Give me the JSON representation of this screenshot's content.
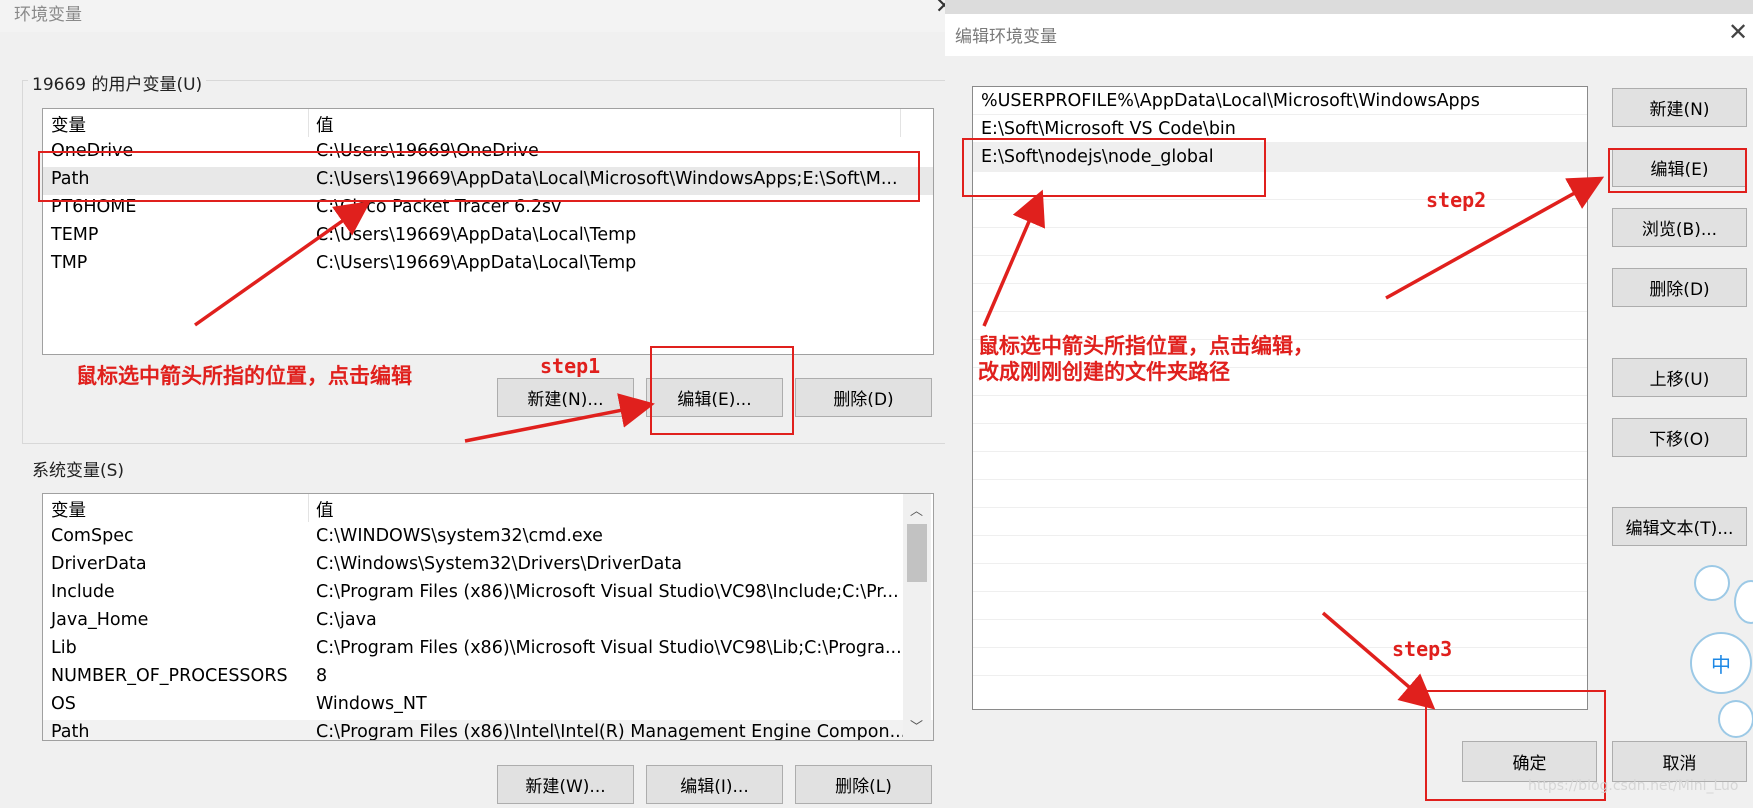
{
  "left_window": {
    "title": "环境变量",
    "user_group_label": "19669 的用户变量(U)",
    "system_group_label": "系统变量(S)",
    "columns": [
      "变量",
      "值"
    ],
    "user_vars": [
      {
        "name": "OneDrive",
        "value": "C:\\Users\\19669\\OneDrive"
      },
      {
        "name": "Path",
        "value": "C:\\Users\\19669\\AppData\\Local\\Microsoft\\WindowsApps;E:\\Soft\\M..."
      },
      {
        "name": "PT6HOME",
        "value": "C:\\Cisco Packet Tracer 6.2sv"
      },
      {
        "name": "TEMP",
        "value": "C:\\Users\\19669\\AppData\\Local\\Temp"
      },
      {
        "name": "TMP",
        "value": "C:\\Users\\19669\\AppData\\Local\\Temp"
      }
    ],
    "user_buttons": {
      "new": "新建(N)...",
      "edit": "编辑(E)...",
      "delete": "删除(D)"
    },
    "system_vars": [
      {
        "name": "ComSpec",
        "value": "C:\\WINDOWS\\system32\\cmd.exe"
      },
      {
        "name": "DriverData",
        "value": "C:\\Windows\\System32\\Drivers\\DriverData"
      },
      {
        "name": "Include",
        "value": "C:\\Program Files (x86)\\Microsoft Visual Studio\\VC98\\Include;C:\\Pr..."
      },
      {
        "name": "Java_Home",
        "value": "C:\\java"
      },
      {
        "name": "Lib",
        "value": "C:\\Program Files (x86)\\Microsoft Visual Studio\\VC98\\Lib;C:\\Progra..."
      },
      {
        "name": "NUMBER_OF_PROCESSORS",
        "value": "8"
      },
      {
        "name": "OS",
        "value": "Windows_NT"
      },
      {
        "name": "Path",
        "value": "C:\\Program Files (x86)\\Intel\\Intel(R) Management Engine Compon..."
      }
    ],
    "system_buttons": {
      "new": "新建(W)...",
      "edit": "编辑(I)...",
      "delete": "删除(L)"
    }
  },
  "right_window": {
    "title": "编辑环境变量",
    "paths": [
      "%USERPROFILE%\\AppData\\Local\\Microsoft\\WindowsApps",
      "E:\\Soft\\Microsoft VS Code\\bin",
      "E:\\Soft\\nodejs\\node_global"
    ],
    "buttons": {
      "new": "新建(N)",
      "edit": "编辑(E)",
      "browse": "浏览(B)...",
      "delete": "删除(D)",
      "move_up": "上移(U)",
      "move_down": "下移(O)",
      "edit_text": "编辑文本(T)...",
      "ok": "确定",
      "cancel": "取消"
    },
    "ime_badge": "中"
  },
  "annotations": {
    "left_note": "鼠标选中箭头所指的位置，点击编辑",
    "right_note_line1": "鼠标选中箭头所指位置，点击编辑，",
    "right_note_line2": "改成刚刚创建的文件夹路径",
    "step1": "step1",
    "step2": "step2",
    "step3": "step3",
    "color": "#e0201d"
  },
  "watermark": "https://blog.csdn.net/Mini_Luo"
}
